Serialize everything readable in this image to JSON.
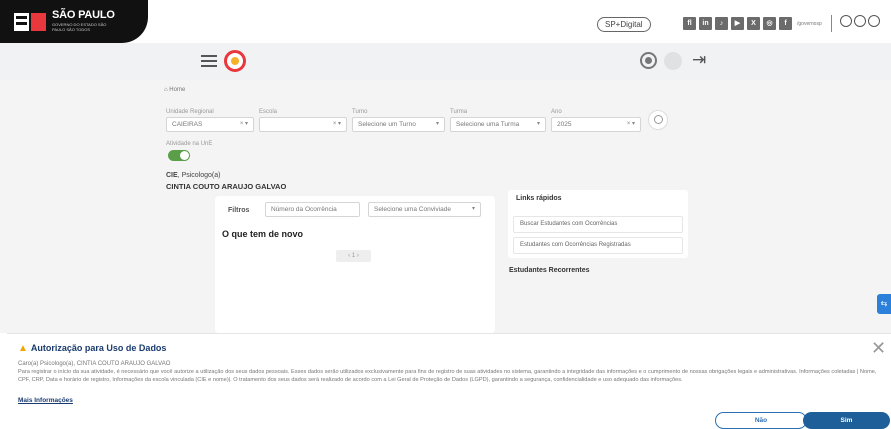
{
  "header": {
    "logo_title": "SÃO PAULO",
    "logo_subtitle": "GOVERNO DO ESTADO SÃO PAULO SÃO TODOS",
    "sp_digital": "SP+Digital",
    "gov_label": "/governosp"
  },
  "breadcrumb": "Home",
  "filters_top": {
    "unidade_label": "Unidade Regional",
    "unidade_value": "CAIEIRAS",
    "escola_label": "Escola",
    "escola_value": "",
    "turno_label": "Turno",
    "turno_placeholder": "Selecione um Turno",
    "turma_label": "Turma",
    "turma_placeholder": "Selecione uma Turma",
    "ano_label": "Ano",
    "ano_value": "2025",
    "switch_label": "Atividade na UnE"
  },
  "user": {
    "role_prefix": "CIE",
    "role": "Psicologo(a)",
    "name": "CINTIA COUTO ARAUJO GALVAO"
  },
  "panel": {
    "filters_title": "Filtros",
    "occurrence_placeholder": "Número da Ocorrência",
    "activity_placeholder": "Selecione uma Conviviade",
    "news_title": "O que tem de novo",
    "pager": "‹ 1 ›"
  },
  "quick_links": {
    "title": "Links rápidos",
    "items": [
      "Buscar Estudantes com Ocorrências",
      "Estudantes com Ocorrências Registradas"
    ],
    "recent_title": "Estudantes Recorrentes"
  },
  "modal": {
    "title": "Autorização para Uso de Dados",
    "user_line": "Caro(a) Psicologo(a), CINTIA COUTO ARAUJO GALVAO",
    "body": "Para registrar o início da sua atividade, é necessário que você autorize a utilização dos seus dados pessoais. Esses dados serão utilizados exclusivamente para fins de registro de suas atividades no sistema, garantindo a integridade das informações e o cumprimento de nossas obrigações legais e administrativas. Informações coletadas | Nome, CPF, CRP, Data e horário de registro, Informações da escola vinculada (CIE e nome)|. O tratamento dos seus dados será realizado de acordo com a Lei Geral de Proteção de Dados (LGPD), garantindo a segurança, confidencialidade e uso adequado das informações.",
    "more_link": "Mais Informações",
    "no_label": "Não",
    "yes_label": "Sim"
  },
  "colors": {
    "brand_navy": "#1a3b6e",
    "switch_green": "#5b9e4a",
    "primary_button": "#1f5f99",
    "accent_red": "#e8383d"
  }
}
